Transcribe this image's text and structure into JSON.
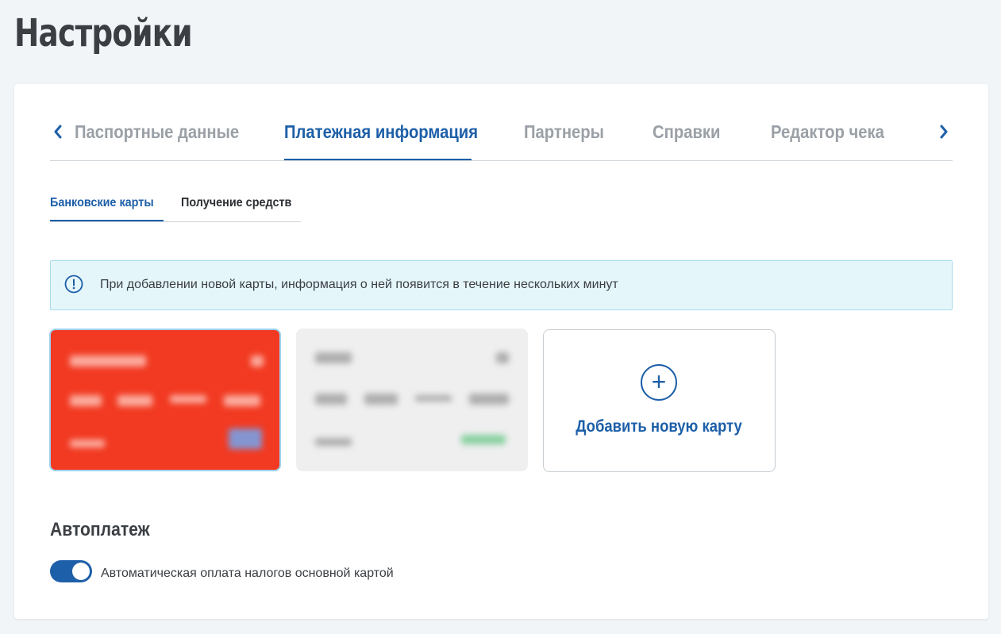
{
  "page": {
    "title": "Настройки"
  },
  "main_tabs": [
    {
      "label": "Паспортные данные",
      "active": false
    },
    {
      "label": "Платежная информация",
      "active": true
    },
    {
      "label": "Партнеры",
      "active": false
    },
    {
      "label": "Справки",
      "active": false
    },
    {
      "label": "Редактор чека",
      "active": false
    }
  ],
  "main_tabs_nav": {
    "prev_icon": "chevron-left-icon",
    "next_icon": "chevron-right-icon"
  },
  "sub_tabs": [
    {
      "label": "Банковские карты",
      "active": true
    },
    {
      "label": "Получение средств",
      "active": false
    }
  ],
  "info": {
    "icon": "info-icon",
    "text": "При добавлении новой карты, информация о ней появится в течение нескольких минут"
  },
  "cards": [
    {
      "state": "selected",
      "background": "#f23a22",
      "details": "blurred"
    },
    {
      "state": "default",
      "background": "#efefef",
      "details": "blurred"
    }
  ],
  "add_card": {
    "label": "Добавить новую карту",
    "icon": "plus-circle-icon"
  },
  "autopay": {
    "title": "Автоплатеж",
    "toggle_on": true,
    "toggle_label": "Автоматическая оплата налогов основной картой"
  },
  "colors": {
    "accent": "#1d5fa8",
    "info_bg": "#e5f6fb",
    "info_border": "#aadbea",
    "muted_tab": "#9aa0a6"
  }
}
